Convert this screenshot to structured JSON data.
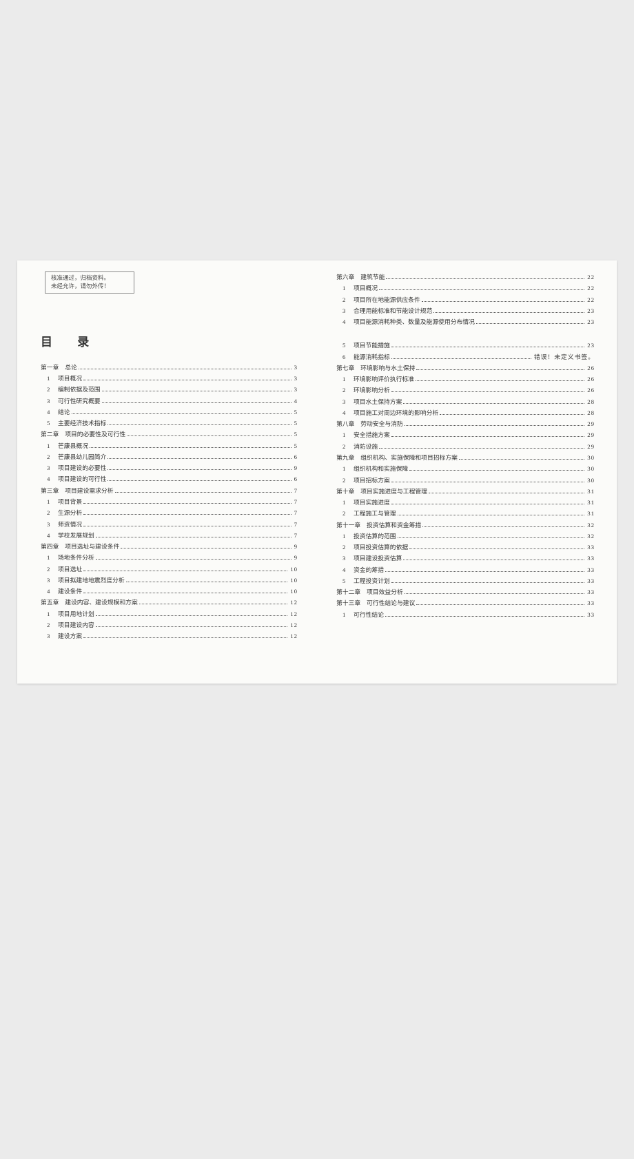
{
  "notice": {
    "line1": "核准通过，归档资料。",
    "line2": "未经允许，请勿外传！"
  },
  "toc_title": "目 录",
  "left": [
    {
      "type": "chapter",
      "label": "第一章　总论",
      "page": "3"
    },
    {
      "type": "sub",
      "num": "1",
      "label": "项目概况",
      "page": "3"
    },
    {
      "type": "sub",
      "num": "2",
      "label": "编制依据及范围",
      "page": "3"
    },
    {
      "type": "sub",
      "num": "3",
      "label": "可行性研究概要",
      "page": "4"
    },
    {
      "type": "sub",
      "num": "4",
      "label": "结论",
      "page": "5"
    },
    {
      "type": "sub",
      "num": "5",
      "label": "主要经济技术指标",
      "page": "5"
    },
    {
      "type": "chapter",
      "label": "第二章　项目的必要性及可行性",
      "page": "5"
    },
    {
      "type": "sub",
      "num": "1",
      "label": "芒康县概况",
      "page": "5"
    },
    {
      "type": "sub",
      "num": "2",
      "label": "芒康县幼儿园简介",
      "page": "6"
    },
    {
      "type": "sub",
      "num": "3",
      "label": "项目建设的必要性",
      "page": "9"
    },
    {
      "type": "sub",
      "num": "4",
      "label": "项目建设的可行性",
      "page": "6"
    },
    {
      "type": "chapter",
      "label": "第三章　项目建设需求分析",
      "page": "7"
    },
    {
      "type": "sub",
      "num": "1",
      "label": "项目背景",
      "page": "7"
    },
    {
      "type": "sub",
      "num": "2",
      "label": "生源分析",
      "page": "7"
    },
    {
      "type": "sub",
      "num": "3",
      "label": "师资情况",
      "page": "7"
    },
    {
      "type": "sub",
      "num": "4",
      "label": "学校发展规划",
      "page": "7"
    },
    {
      "type": "chapter",
      "label": "第四章　项目选址与建设条件",
      "page": "9"
    },
    {
      "type": "sub",
      "num": "1",
      "label": "场地条件分析",
      "page": "9"
    },
    {
      "type": "sub",
      "num": "2",
      "label": "项目选址",
      "page": "10"
    },
    {
      "type": "sub",
      "num": "3",
      "label": "项目拟建地地震烈度分析",
      "page": "10"
    },
    {
      "type": "sub",
      "num": "4",
      "label": "建设条件",
      "page": "10"
    },
    {
      "type": "chapter",
      "label": "第五章　建设内容、建设规模和方案",
      "page": "12"
    },
    {
      "type": "sub",
      "num": "1",
      "label": "项目用地计划",
      "page": "12"
    },
    {
      "type": "sub",
      "num": "2",
      "label": "项目建设内容",
      "page": "12"
    },
    {
      "type": "sub",
      "num": "3",
      "label": "建设方案",
      "page": "12"
    }
  ],
  "right_top": [
    {
      "type": "chapter",
      "label": "第六章　建筑节能",
      "page": "22"
    },
    {
      "type": "sub",
      "num": "1",
      "label": "项目概况",
      "page": "22"
    },
    {
      "type": "sub",
      "num": "2",
      "label": "项目所在地能源供应条件",
      "page": "22"
    },
    {
      "type": "sub",
      "num": "3",
      "label": "合理用能标准和节能设计规范",
      "page": "23"
    },
    {
      "type": "sub",
      "num": "4",
      "label": "项目能源消耗种类、数量及能源使用分布情况",
      "page": "23"
    }
  ],
  "right_bottom": [
    {
      "type": "sub",
      "num": "5",
      "label": "项目节能措施",
      "page": "23"
    },
    {
      "type": "sub",
      "num": "6",
      "label": "能源消耗指标",
      "page": "错误！未定义书签。"
    },
    {
      "type": "chapter",
      "label": "第七章　环境影响与水土保持",
      "page": "26"
    },
    {
      "type": "sub",
      "num": "1",
      "label": "环境影响评价执行标准",
      "page": "26"
    },
    {
      "type": "sub",
      "num": "2",
      "label": "环境影响分析",
      "page": "26"
    },
    {
      "type": "sub",
      "num": "3",
      "label": "项目水土保持方案",
      "page": "28"
    },
    {
      "type": "sub",
      "num": "4",
      "label": "项目施工对周边环境的影响分析",
      "page": "28"
    },
    {
      "type": "chapter",
      "label": "第八章　劳动安全与消防",
      "page": "29"
    },
    {
      "type": "sub",
      "num": "1",
      "label": "安全措施方案",
      "page": "29"
    },
    {
      "type": "sub",
      "num": "2",
      "label": "消防设施",
      "page": "29"
    },
    {
      "type": "chapter",
      "label": "第九章　组织机构、实施保障和项目招标方案",
      "page": "30"
    },
    {
      "type": "sub",
      "num": "1",
      "label": "组织机构和实施保障",
      "page": "30"
    },
    {
      "type": "sub",
      "num": "2",
      "label": "项目招标方案",
      "page": "30"
    },
    {
      "type": "chapter",
      "label": "第十章　项目实施进度与工程管理",
      "page": "31"
    },
    {
      "type": "sub",
      "num": "1",
      "label": "项目实施进度",
      "page": "31"
    },
    {
      "type": "sub",
      "num": "2",
      "label": "工程施工与管理",
      "page": "31"
    },
    {
      "type": "chapter",
      "label": "第十一章　投资估算和资金筹措",
      "page": "32"
    },
    {
      "type": "sub",
      "num": "1",
      "label": "投资估算的范围",
      "page": "32"
    },
    {
      "type": "sub",
      "num": "2",
      "label": "项目投资估算的依据",
      "page": "33"
    },
    {
      "type": "sub",
      "num": "3",
      "label": "项目建设投资估算",
      "page": "33"
    },
    {
      "type": "sub",
      "num": "4",
      "label": "资金的筹措",
      "page": "33"
    },
    {
      "type": "sub",
      "num": "5",
      "label": "工程投资计划",
      "page": "33"
    },
    {
      "type": "chapter",
      "label": "第十二章　项目效益分析",
      "page": "33"
    },
    {
      "type": "chapter",
      "label": "第十三章　可行性结论与建议",
      "page": "33"
    },
    {
      "type": "sub",
      "num": "1",
      "label": "可行性结论",
      "page": "33"
    }
  ]
}
